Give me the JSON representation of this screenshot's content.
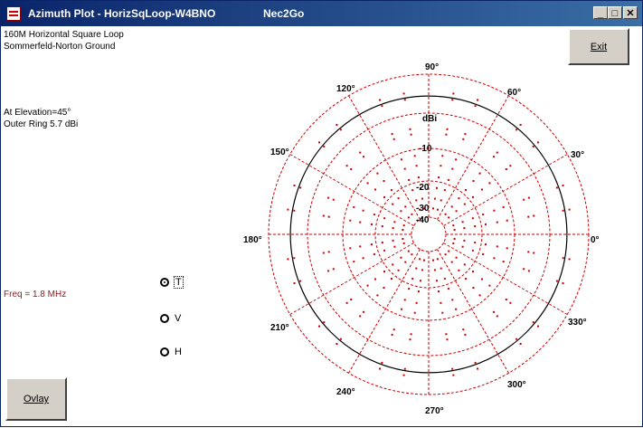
{
  "window": {
    "title": "Azimuth Plot - HorizSqLoop-W4BNO",
    "app_name": "Nec2Go",
    "controls": {
      "minimize": "_",
      "maximize": "□",
      "close": "✕"
    }
  },
  "info": {
    "line1": "160M Horizontal Square Loop",
    "line2": "Sommerfeld-Norton Ground",
    "elevation": "At Elevation=45°",
    "outer_ring": "Outer Ring 5.7 dBi",
    "freq": "Freq = 1.8 MHz"
  },
  "buttons": {
    "exit": "Exit",
    "ovlay": "Ovlay"
  },
  "polarization": {
    "options": [
      {
        "label": "T",
        "selected": true
      },
      {
        "label": "V",
        "selected": false
      },
      {
        "label": "H",
        "selected": false
      }
    ]
  },
  "chart_data": {
    "type": "polar",
    "unit_label": "dBi",
    "outer_ring_dbi": 5.7,
    "ring_labels": [
      "-10",
      "-20",
      "-30",
      "-40"
    ],
    "angle_labels": [
      "0°",
      "30°",
      "60°",
      "90°",
      "120°",
      "150°",
      "180°",
      "210°",
      "240°",
      "270°",
      "300°",
      "330°"
    ],
    "angles_deg": [
      0,
      30,
      60,
      90,
      120,
      150,
      180,
      210,
      240,
      270,
      300,
      330
    ],
    "pattern": {
      "name": "",
      "gain_dbi_all_azimuths": -1.1,
      "shape": "circle"
    },
    "colors": {
      "grid": "#cc0000",
      "pattern": "#000000"
    }
  }
}
